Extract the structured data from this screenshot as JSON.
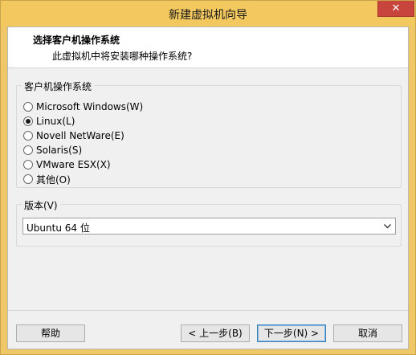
{
  "window": {
    "title": "新建虚拟机向导",
    "close_label": "✕"
  },
  "header": {
    "title": "选择客户机操作系统",
    "subtitle": "此虚拟机中将安装哪种操作系统?"
  },
  "os_group": {
    "legend": "客户机操作系统",
    "options": [
      {
        "label": "Microsoft Windows(W)",
        "checked": false
      },
      {
        "label": "Linux(L)",
        "checked": true
      },
      {
        "label": "Novell NetWare(E)",
        "checked": false
      },
      {
        "label": "Solaris(S)",
        "checked": false
      },
      {
        "label": "VMware ESX(X)",
        "checked": false
      },
      {
        "label": "其他(O)",
        "checked": false
      }
    ]
  },
  "version_group": {
    "legend": "版本(V)",
    "selected": "Ubuntu 64 位"
  },
  "buttons": {
    "help": "帮助",
    "back": "< 上一步(B)",
    "next": "下一步(N) >",
    "cancel": "取消"
  },
  "colors": {
    "title_bar": "#f3c85f",
    "close_button": "#c7453c",
    "dialog_bg": "#f0f0f0"
  }
}
